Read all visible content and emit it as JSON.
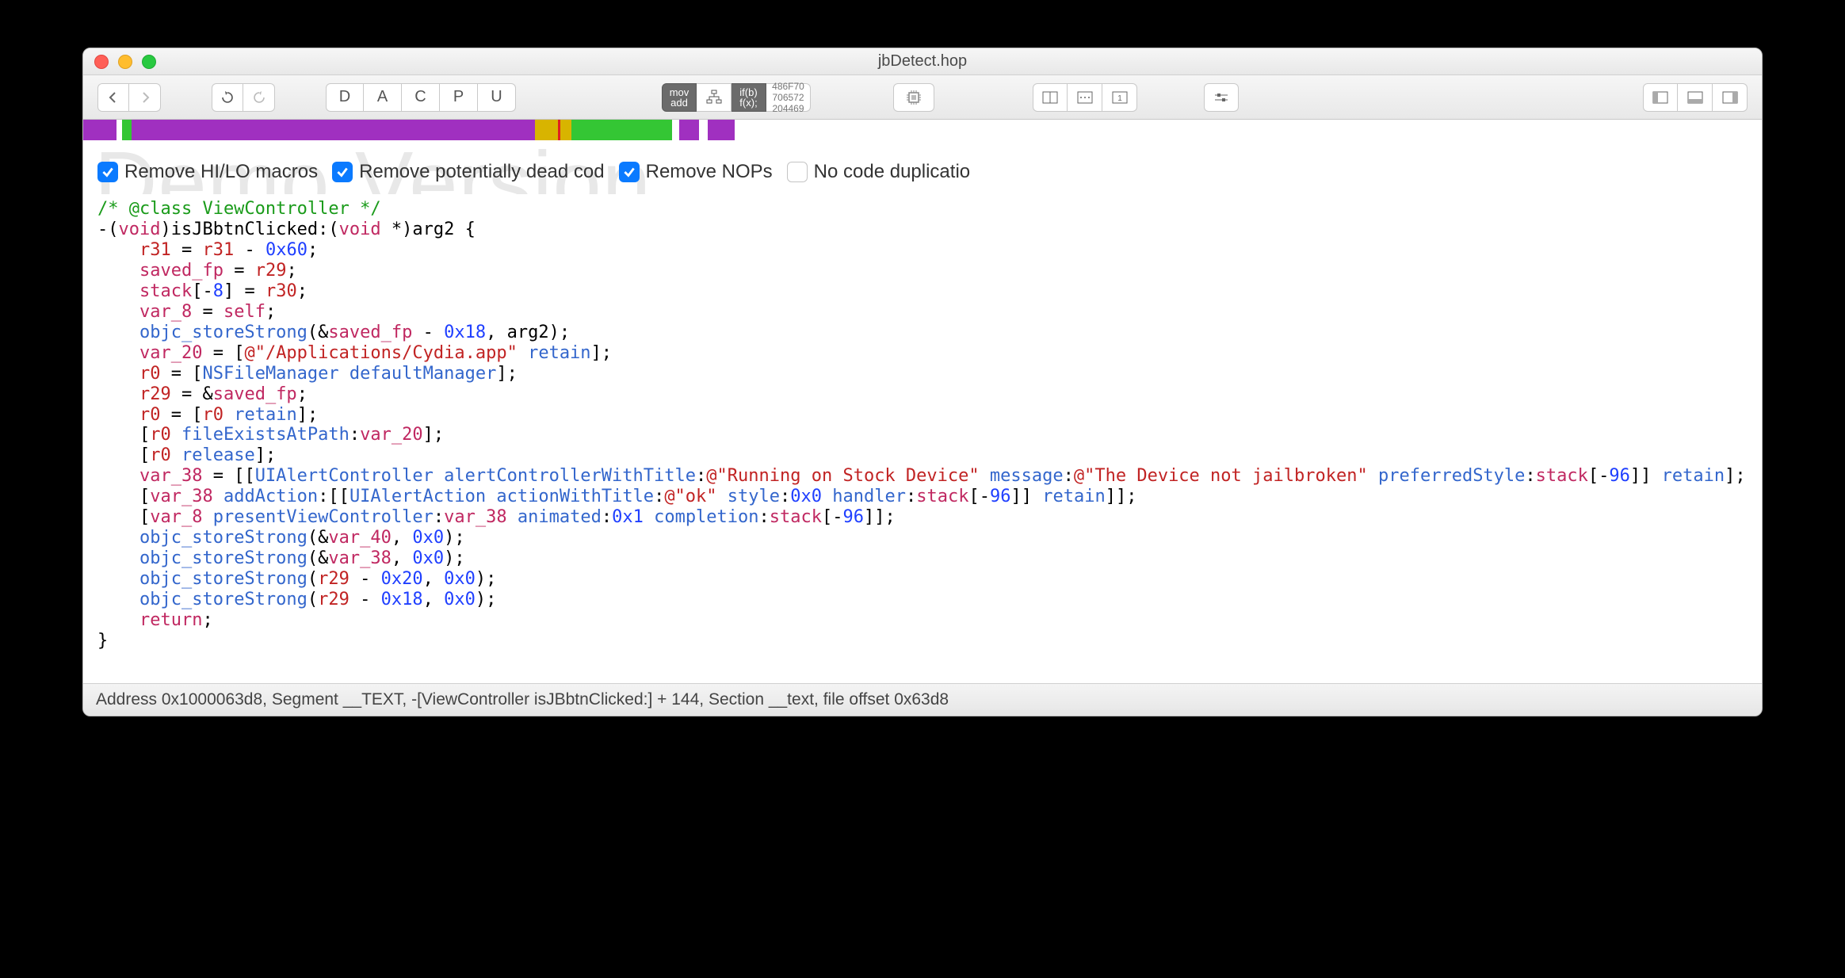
{
  "title": "jbDetect.hop",
  "watermark": "Demo Version",
  "toolbar": {
    "mode_D": "D",
    "mode_A": "A",
    "mode_C": "C",
    "mode_P": "P",
    "mode_U": "U",
    "asm_label1": "mov",
    "asm_label2": "add",
    "cfg_label1": "if(b)",
    "cfg_label2": "f(x);",
    "hex1": "486F70",
    "hex2": "706572",
    "hex3": "204469"
  },
  "navmap": [
    {
      "color": "#a030c0",
      "width": 2.0
    },
    {
      "color": "#ffffff",
      "width": 0.3
    },
    {
      "color": "#34c634",
      "width": 0.6
    },
    {
      "color": "#a030c0",
      "width": 24.0
    },
    {
      "color": "#d8b400",
      "width": 2.2
    },
    {
      "color": "#34c634",
      "width": 6.0
    },
    {
      "color": "#ffffff",
      "width": 0.4
    },
    {
      "color": "#a030c0",
      "width": 1.2
    },
    {
      "color": "#ffffff",
      "width": 0.5
    },
    {
      "color": "#a030c0",
      "width": 1.6
    },
    {
      "color": "#ffffff",
      "width": 61.2
    }
  ],
  "red_marker_pct": 28.3,
  "options": {
    "remove_hilo": {
      "label": "Remove HI/LO macros",
      "checked": true
    },
    "remove_dead": {
      "label": "Remove potentially dead cod",
      "checked": true
    },
    "remove_nops": {
      "label": "Remove NOPs",
      "checked": true
    },
    "no_dup": {
      "label": "No code duplicatio",
      "checked": false
    }
  },
  "code": {
    "comment": "/* @class ViewController */",
    "sig_prefix": "-(",
    "sig_void1": "void",
    "sig_mid1": ")isJBbtnClicked:(",
    "sig_void2": "void",
    "sig_mid2": " *)arg2 {",
    "l3a": "r31",
    "l3b": " = ",
    "l3c": "r31",
    "l3d": " - ",
    "l3e": "0x60",
    "l3f": ";",
    "l4a": "saved_fp",
    "l4b": " = ",
    "l4c": "r29",
    "l4d": ";",
    "l5a": "stack",
    "l5b": "[-",
    "l5c": "8",
    "l5d": "] = ",
    "l5e": "r30",
    "l5f": ";",
    "l6a": "var_8",
    "l6b": " = ",
    "l6c": "self",
    "l6d": ";",
    "l7a": "objc_storeStrong",
    "l7b": "(&",
    "l7c": "saved_fp",
    "l7d": " - ",
    "l7e": "0x18",
    "l7f": ", arg2);",
    "l8a": "var_20",
    "l8b": " = [",
    "l8c": "@\"/Applications/Cydia.app\"",
    "l8d": " ",
    "l8e": "retain",
    "l8f": "];",
    "l9a": "r0",
    "l9b": " = [",
    "l9c": "NSFileManager",
    "l9d": " ",
    "l9e": "defaultManager",
    "l9f": "];",
    "l10a": "r29",
    "l10b": " = &",
    "l10c": "saved_fp",
    "l10d": ";",
    "l11a": "r0",
    "l11b": " = [",
    "l11c": "r0",
    "l11d": " ",
    "l11e": "retain",
    "l11f": "];",
    "l12a": "[",
    "l12b": "r0",
    "l12c": " ",
    "l12d": "fileExistsAtPath",
    "l12e": ":",
    "l12f": "var_20",
    "l12g": "];",
    "l13a": "[",
    "l13b": "r0",
    "l13c": " ",
    "l13d": "release",
    "l13e": "];",
    "l14a": "var_38",
    "l14b": " = [[",
    "l14c": "UIAlertController",
    "l14d": " ",
    "l14e": "alertControllerWithTitle",
    "l14f": ":",
    "l14g": "@\"Running on Stock Device\"",
    "l14h": " ",
    "l14i": "message",
    "l14j": ":",
    "l14k": "@\"The Device not jailbroken\"",
    "l14l": " ",
    "l14m": "preferredStyle",
    "l14n": ":",
    "l14o": "stack",
    "l14p": "[-",
    "l14q": "96",
    "l14r": "]] ",
    "l14s": "retain",
    "l14t": "];",
    "l15a": "[",
    "l15b": "var_38",
    "l15c": " ",
    "l15d": "addAction",
    "l15e": ":[[",
    "l15f": "UIAlertAction",
    "l15g": " ",
    "l15h": "actionWithTitle",
    "l15i": ":",
    "l15j": "@\"ok\"",
    "l15k": " ",
    "l15l": "style",
    "l15m": ":",
    "l15n": "0x0",
    "l15o": " ",
    "l15p": "handler",
    "l15q": ":",
    "l15r": "stack",
    "l15s": "[-",
    "l15t": "96",
    "l15u": "]] ",
    "l15v": "retain",
    "l15w": "]];",
    "l16a": "[",
    "l16b": "var_8",
    "l16c": " ",
    "l16d": "presentViewController",
    "l16e": ":",
    "l16f": "var_38",
    "l16g": " ",
    "l16h": "animated",
    "l16i": ":",
    "l16j": "0x1",
    "l16k": " ",
    "l16l": "completion",
    "l16m": ":",
    "l16n": "stack",
    "l16o": "[-",
    "l16p": "96",
    "l16q": "]];",
    "l17a": "objc_storeStrong",
    "l17b": "(&",
    "l17c": "var_40",
    "l17d": ", ",
    "l17e": "0x0",
    "l17f": ");",
    "l18a": "objc_storeStrong",
    "l18b": "(&",
    "l18c": "var_38",
    "l18d": ", ",
    "l18e": "0x0",
    "l18f": ");",
    "l19a": "objc_storeStrong",
    "l19b": "(",
    "l19c": "r29",
    "l19d": " - ",
    "l19e": "0x20",
    "l19f": ", ",
    "l19g": "0x0",
    "l19h": ");",
    "l20a": "objc_storeStrong",
    "l20b": "(",
    "l20c": "r29",
    "l20d": " - ",
    "l20e": "0x18",
    "l20f": ", ",
    "l20g": "0x0",
    "l20h": ");",
    "l21a": "return",
    "l21b": ";",
    "l22": "}"
  },
  "status": "Address 0x1000063d8, Segment __TEXT, -[ViewController isJBbtnClicked:] + 144, Section __text, file offset 0x63d8"
}
